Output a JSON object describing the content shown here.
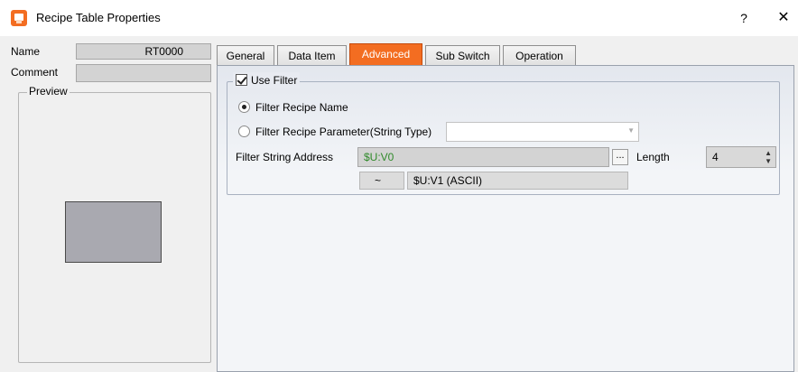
{
  "window": {
    "title": "Recipe Table Properties",
    "help": "?",
    "close": "✕"
  },
  "left": {
    "name_label": "Name",
    "name_value": "RT0000",
    "comment_label": "Comment",
    "comment_value": "",
    "preview_label": "Preview"
  },
  "tabs": [
    {
      "label": "General"
    },
    {
      "label": "Data Item"
    },
    {
      "label": "Advanced"
    },
    {
      "label": "Sub Switch"
    },
    {
      "label": "Operation"
    }
  ],
  "advanced": {
    "use_filter_label": "Use Filter",
    "use_filter_checked": true,
    "radio_name_label": "Filter Recipe Name",
    "radio_param_label": "Filter Recipe Parameter(String Type)",
    "param_combo_value": "",
    "filter_address_label": "Filter String Address",
    "filter_address_value": "$U:V0",
    "dots_button": "...",
    "length_label": "Length",
    "length_value": "4",
    "range_tilde": "~",
    "range_end_value": "$U:V1 (ASCII)"
  },
  "colors": {
    "accent": "#f36d21",
    "address_text": "#2f8a2a"
  }
}
